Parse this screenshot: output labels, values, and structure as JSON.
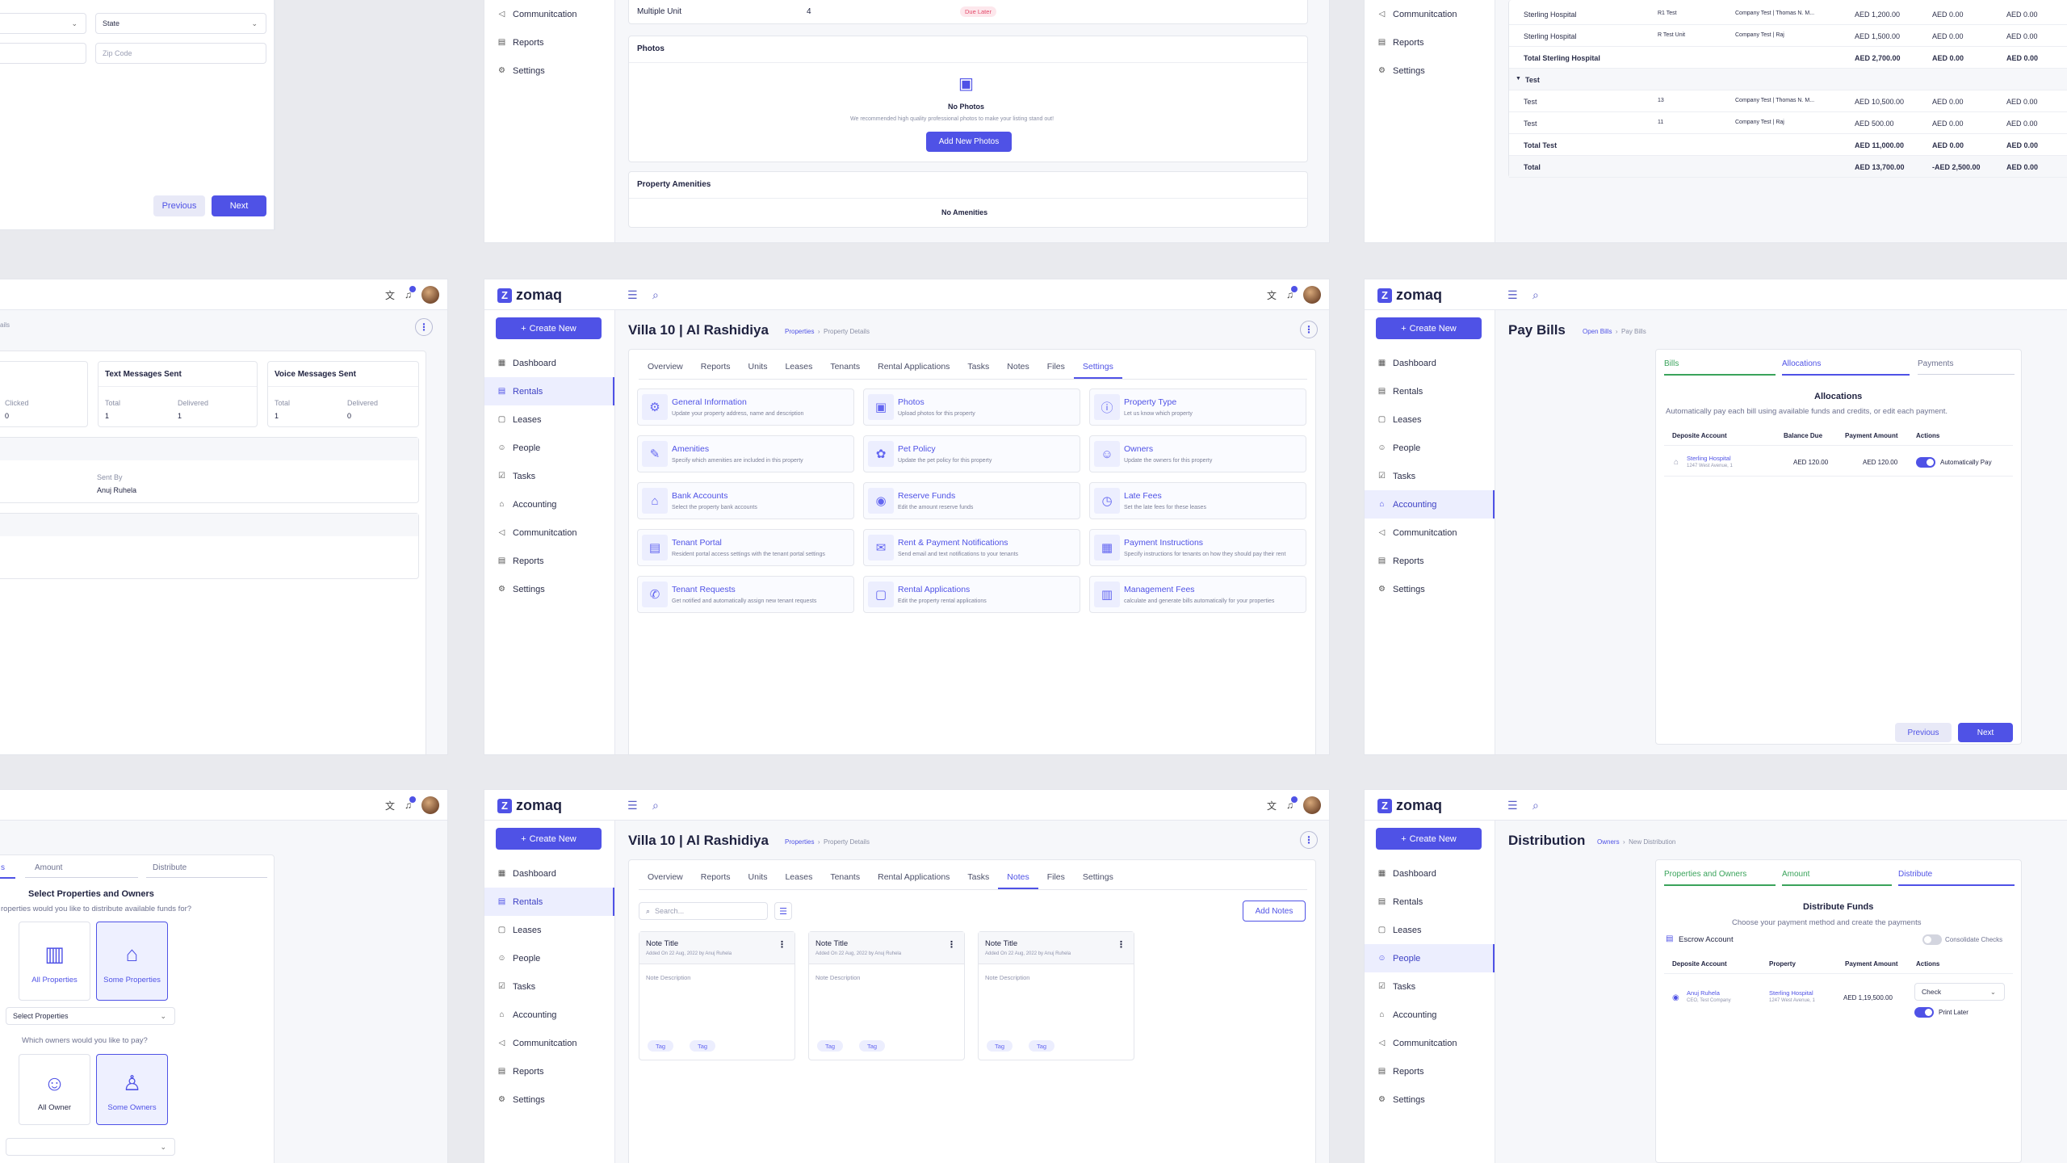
{
  "app": {
    "logo": "zomaq",
    "create_new": "Create New",
    "nav": [
      "Dashboard",
      "Rentals",
      "Leases",
      "People",
      "Tasks",
      "Accounting",
      "Communitcation",
      "Reports",
      "Settings"
    ]
  },
  "top_left": {
    "state_placeholder": "State",
    "zip_placeholder": "Zip Code",
    "previous": "Previous",
    "next": "Next"
  },
  "top_mid": {
    "unit_label": "Multiple Unit",
    "unit_count": "4",
    "due_badge": "Due Later",
    "photos_title": "Photos",
    "no_photos": "No Photos",
    "photos_hint": "We recommended high quality professional photos to make your listing stand out!",
    "add_photos": "Add New Photos",
    "amenities_title": "Property Amenities",
    "no_amenities": "No Amenities"
  },
  "top_right": {
    "rows": [
      {
        "name": "Sterling Hospital",
        "unit": "R1 Test",
        "company": "Company Test | Thomas N. M...",
        "a": "AED 1,200.00",
        "b": "AED 0.00",
        "c": "AED 0.00"
      },
      {
        "name": "Sterling Hospital",
        "unit": "R Test Unit",
        "company": "Company Test | Raj",
        "a": "AED 1,500.00",
        "b": "AED 0.00",
        "c": "AED 0.00"
      },
      {
        "name": "Total Sterling Hospital",
        "unit": "",
        "company": "",
        "a": "AED 2,700.00",
        "b": "AED 0.00",
        "c": "AED 0.00"
      },
      {
        "name": "Test",
        "unit": "",
        "company": "",
        "a": "",
        "b": "",
        "c": ""
      },
      {
        "name": "Test",
        "unit": "13",
        "company": "Company Test | Thomas N. M...",
        "a": "AED 10,500.00",
        "b": "AED 0.00",
        "c": "AED 0.00"
      },
      {
        "name": "Test",
        "unit": "11",
        "company": "Company Test | Raj",
        "a": "AED 500.00",
        "b": "AED 0.00",
        "c": "AED 0.00"
      },
      {
        "name": "Total Test",
        "unit": "",
        "company": "",
        "a": "AED 11,000.00",
        "b": "AED 0.00",
        "c": "AED 0.00"
      },
      {
        "name": "Total",
        "unit": "",
        "company": "",
        "a": "AED 13,700.00",
        "b": "-AED 2,500.00",
        "c": "AED 0.00"
      }
    ]
  },
  "mid_left": {
    "text_sent": "Text Messages Sent",
    "voice_sent": "Voice Messages Sent",
    "clicked": "Clicked",
    "clicked_val": "0",
    "total": "Total",
    "delivered": "Delivered",
    "text_total": "1",
    "text_delivered": "1",
    "voice_total": "1",
    "voice_delivered": "0",
    "sent_by": "Sent By",
    "sent_by_name": "Anuj Ruhela"
  },
  "villa": {
    "title": "Villa 10 | Al Rashidiya",
    "bc_link": "Properties",
    "bc_current": "Property Details",
    "tabs": [
      "Overview",
      "Reports",
      "Units",
      "Leases",
      "Tenants",
      "Rental Applications",
      "Tasks",
      "Notes",
      "Files",
      "Settings"
    ],
    "settings": [
      {
        "t": "General Information",
        "d": "Update your property address, name and description",
        "icon": "⚙"
      },
      {
        "t": "Photos",
        "d": "Upload photos for this property",
        "icon": "▣"
      },
      {
        "t": "Property Type",
        "d": "Let us know which property",
        "icon": "ⓘ"
      },
      {
        "t": "Amenities",
        "d": "Specify which amenities are included in this property",
        "icon": "✎"
      },
      {
        "t": "Pet Policy",
        "d": "Update the pet policy for this property",
        "icon": "✿"
      },
      {
        "t": "Owners",
        "d": "Update the owners for this property",
        "icon": "☺"
      },
      {
        "t": "Bank Accounts",
        "d": "Select the property bank accounts",
        "icon": "⌂"
      },
      {
        "t": "Reserve Funds",
        "d": "Edit the amount reserve funds",
        "icon": "◉"
      },
      {
        "t": "Late Fees",
        "d": "Set the late fees for these leases",
        "icon": "◷"
      },
      {
        "t": "Tenant Portal",
        "d": "Resident portal access settings with the tenant portal settings",
        "icon": "▤"
      },
      {
        "t": "Rent & Payment Notifications",
        "d": "Send email and text notifications to your tenants",
        "icon": "✉"
      },
      {
        "t": "Payment Instructions",
        "d": "Specify instructions for tenants on how they should pay their rent",
        "icon": "▦"
      },
      {
        "t": "Tenant Requests",
        "d": "Get notified and automatically assign new tenant requests",
        "icon": "✆"
      },
      {
        "t": "Rental Applications",
        "d": "Edit the property rental applications",
        "icon": "▢"
      },
      {
        "t": "Management Fees",
        "d": "calculate and generate bills automatically for your properties",
        "icon": "▥"
      }
    ]
  },
  "paybills": {
    "title": "Pay Bills",
    "bc_link": "Open Bills",
    "bc_current": "Pay Bills",
    "steps": [
      "Bills",
      "Allocations",
      "Payments"
    ],
    "heading": "Allocations",
    "sub": "Automatically pay each bill using available funds and credits, or edit each payment.",
    "cols": [
      "Deposite Account",
      "Balance Due",
      "Payment Amount",
      "Actions"
    ],
    "acct_name": "Sterling Hospital",
    "acct_addr": "1247 West Avenue, 1",
    "balance": "AED 120.00",
    "payment": "AED 120.00",
    "action": "Automatically Pay",
    "previous": "Previous",
    "next": "Next"
  },
  "bottom_left": {
    "steps": [
      "s",
      "Amount",
      "Distribute"
    ],
    "heading": "Select Properties and Owners",
    "q1": "roperties would you like to distribute available funds for?",
    "all_props": "All Properties",
    "some_props": "Some Properties",
    "select_props": "Select Properties",
    "q2": "Which owners would you like to pay?",
    "all_owner": "All Owner",
    "some_owners": "Some Owners"
  },
  "notes": {
    "search_placeholder": "Search...",
    "add": "Add Notes",
    "items": [
      {
        "title": "Note Title",
        "meta": "Added On 22 Aug, 2022 by Anuj Ruhela",
        "desc": "Note Description",
        "tags": [
          "Tag",
          "Tag"
        ]
      },
      {
        "title": "Note Title",
        "meta": "Added On 22 Aug, 2022 by Anuj Ruhela",
        "desc": "Note Description",
        "tags": [
          "Tag",
          "Tag"
        ]
      },
      {
        "title": "Note Title",
        "meta": "Added On 22 Aug, 2022 by Anuj Ruhela",
        "desc": "Note Description",
        "tags": [
          "Tag",
          "Tag"
        ]
      }
    ]
  },
  "distribution": {
    "title": "Distribution",
    "bc_link": "Owners",
    "bc_current": "New Distribution",
    "steps": [
      "Properties and Owners",
      "Amount",
      "Distribute"
    ],
    "heading": "Distribute Funds",
    "sub": "Choose your payment method and create the payments",
    "escrow": "Escrow Account",
    "consolidate": "Consolidate Checks",
    "cols": [
      "Deposite Account",
      "Property",
      "Payment Amount",
      "Actions"
    ],
    "owner_name": "Anuj Ruhela",
    "owner_sub": "CEO, Test Company",
    "prop_name": "Sterling Hospital",
    "prop_addr": "1247 West Avenue, 1",
    "amount": "AED 1,19,500.00",
    "method": "Check",
    "print_later": "Print Later"
  }
}
